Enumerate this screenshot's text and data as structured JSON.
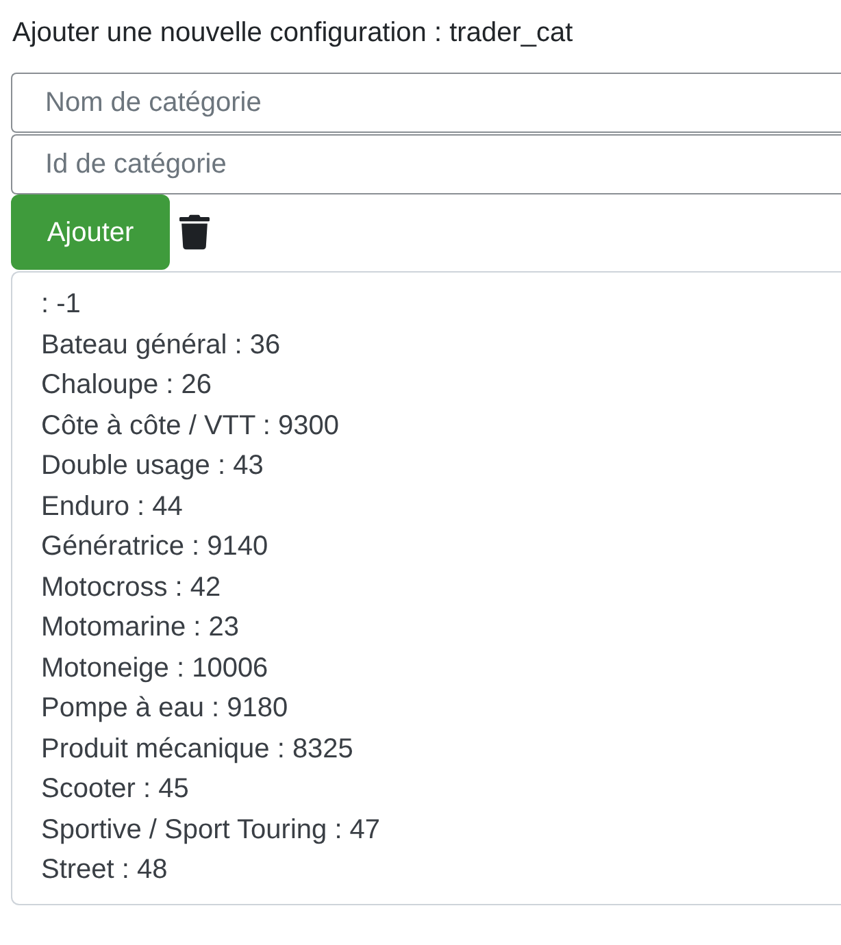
{
  "heading": "Ajouter une nouvelle configuration : trader_cat",
  "fields": [
    {
      "placeholder": "Nom de catégorie"
    },
    {
      "placeholder": "Id de catégorie"
    }
  ],
  "add_button": "Ajouter",
  "categories": [
    ": -1",
    "Bateau général : 36",
    "Chaloupe : 26",
    "Côte à côte / VTT : 9300",
    "Double usage : 43",
    "Enduro : 44",
    "Génératrice : 9140",
    "Motocross : 42",
    "Motomarine : 23",
    "Motoneige : 10006",
    "Pompe à eau : 9180",
    "Produit mécanique : 8325",
    "Scooter : 45",
    "Sportive / Sport Touring : 47",
    "Street : 48"
  ]
}
